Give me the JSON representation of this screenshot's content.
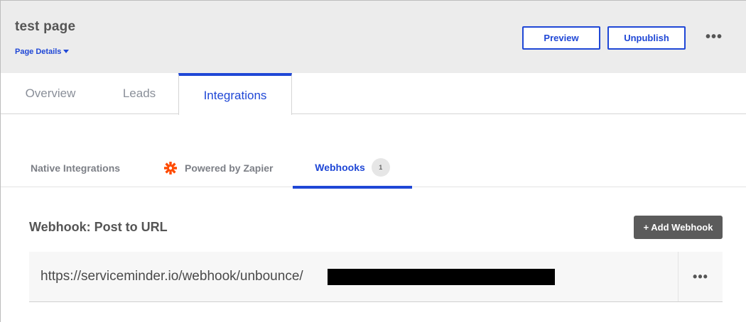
{
  "header": {
    "title": "test page",
    "page_details_label": "Page Details",
    "preview_label": "Preview",
    "unpublish_label": "Unpublish",
    "more_label": "•••"
  },
  "main_tabs": [
    {
      "label": "Overview",
      "active": false
    },
    {
      "label": "Leads",
      "active": false
    },
    {
      "label": "Integrations",
      "active": true
    }
  ],
  "sub_tabs": [
    {
      "label": "Native Integrations",
      "active": false
    },
    {
      "label": "Powered by Zapier",
      "active": false,
      "icon": "zapier-icon"
    },
    {
      "label": "Webhooks",
      "active": true,
      "badge": "1"
    }
  ],
  "webhook_section": {
    "title": "Webhook: Post to URL",
    "add_button_label": "+ Add Webhook",
    "rows": [
      {
        "url": "https://serviceminder.io/webhook/unbounce/",
        "more_label": "•••"
      }
    ]
  },
  "colors": {
    "accent": "#1f47d6",
    "header_bg": "#ececec",
    "add_button_bg": "#5b5b5b",
    "zapier": "#ff4a00"
  }
}
